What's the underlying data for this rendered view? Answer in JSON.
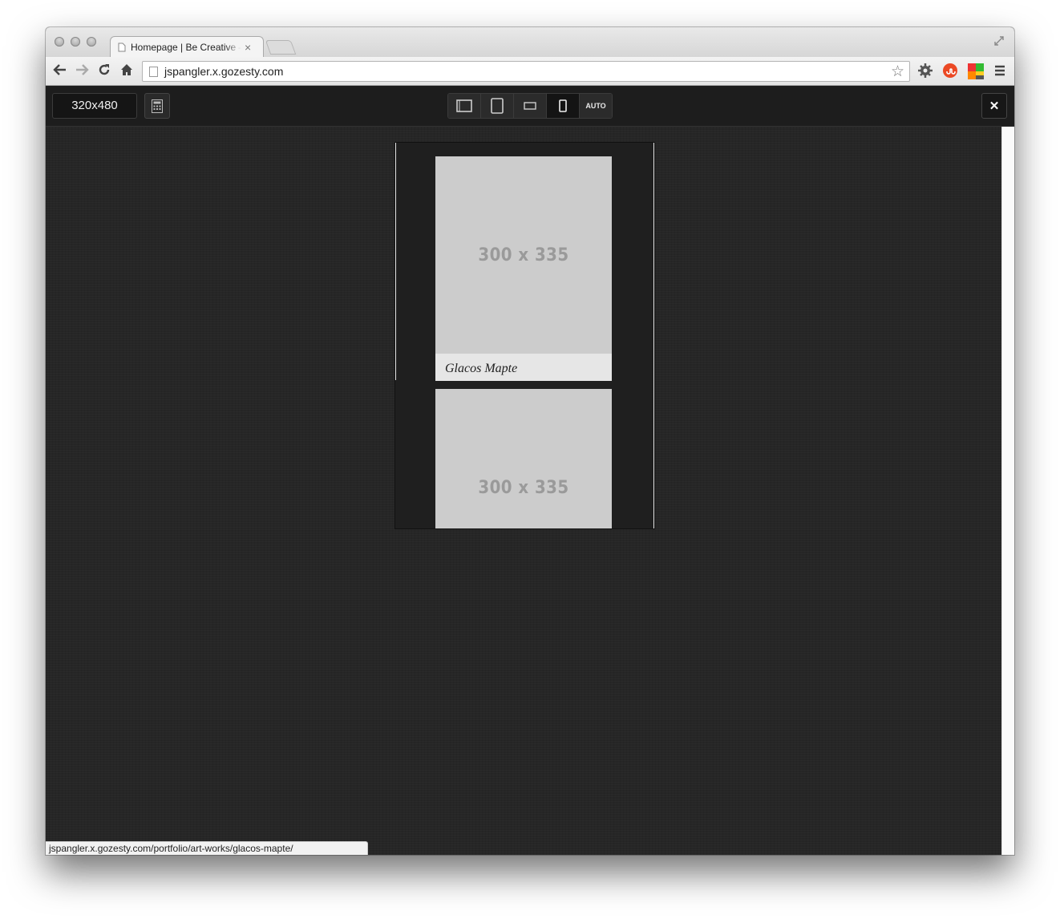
{
  "browser": {
    "tab_title": "Homepage | Be Creative – ",
    "tab_close": "×",
    "url": "jspangler.x.gozesty.com",
    "status_url": "jspangler.x.gozesty.com/portfolio/art-works/glacos-mapte/"
  },
  "tester": {
    "size_label": "320x480",
    "device_buttons": [
      {
        "name": "desktop-view-icon",
        "active": false
      },
      {
        "name": "tablet-portrait-icon",
        "active": false
      },
      {
        "name": "phone-landscape-icon",
        "active": false
      },
      {
        "name": "phone-portrait-icon",
        "active": true
      }
    ],
    "auto_label": "AUTO",
    "close_label": "✕"
  },
  "site": {
    "cards": [
      {
        "placeholder": "300 x 335",
        "caption": "Glacos Mapte"
      },
      {
        "placeholder": "300 x 335",
        "caption": ""
      }
    ]
  },
  "colors": {
    "tester_bar": "#1d1d1d",
    "placeholder_bg": "#cccccc",
    "placeholder_text": "#9a9a9a",
    "caption_bg": "#e6e6e6"
  }
}
